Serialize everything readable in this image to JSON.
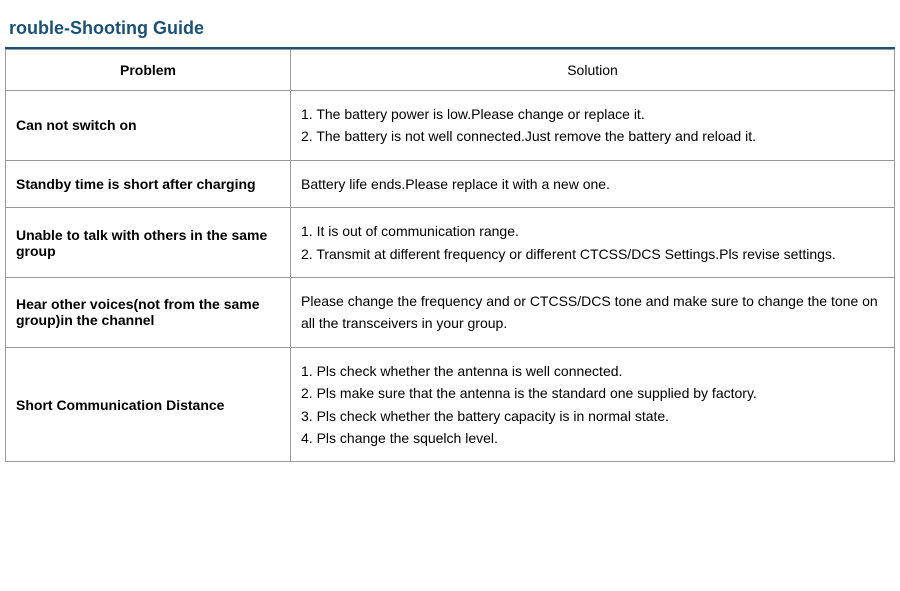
{
  "page": {
    "title": "rouble-Shooting Guide",
    "table": {
      "col_problem": "Problem",
      "col_solution": "Solution",
      "rows": [
        {
          "problem": "Can not switch on",
          "solution": "1. The battery power is low.Please change or replace it.\n2. The battery is not well connected.Just remove the battery and reload it."
        },
        {
          "problem": "Standby time is short after charging",
          "solution": "Battery life ends.Please replace it with a new one."
        },
        {
          "problem": "Unable to talk with others in the same group",
          "solution": "1. It is out of communication range.\n2. Transmit at different frequency or different CTCSS/DCS Settings.Pls revise settings."
        },
        {
          "problem": "Hear other voices(not from the same group)in the channel",
          "solution": "Please change the frequency and or CTCSS/DCS tone and make sure to change the tone on all the transceivers in your group."
        },
        {
          "problem": "Short Communication Distance",
          "solution": "1. Pls check whether the antenna is well connected.\n2. Pls make sure that the antenna is the standard one supplied by factory.\n3. Pls check whether the battery capacity is in normal state.\n4. Pls change the squelch level."
        }
      ]
    }
  }
}
